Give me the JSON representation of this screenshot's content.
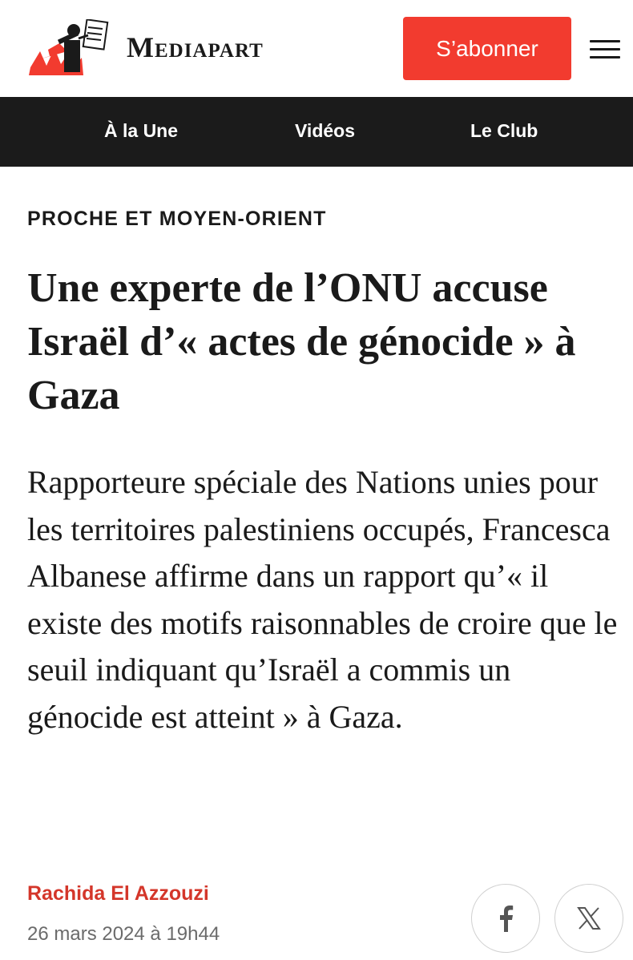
{
  "header": {
    "logo_text": "Mediapart",
    "subscribe_label": "S’abonner",
    "menu_icon": "hamburger-icon",
    "accent_color": "#f23b2f"
  },
  "nav": {
    "items": [
      {
        "label": "À la Une"
      },
      {
        "label": "Vidéos"
      },
      {
        "label": "Le Club"
      }
    ]
  },
  "article": {
    "category": "PROCHE ET MOYEN-ORIENT",
    "title": "Une experte de l’ONU accuse Israël d’« actes de génocide » à Gaza",
    "lead": "Rapporteure spéciale des Nations unies pour les territoires palestiniens occupés, Francesca Albanese affirme dans un rapport qu’« il existe des motifs raisonnables de croire que le seuil indiquant qu’Israël a commis un génocide est atteint » à Gaza.",
    "author": "Rachida El Azzouzi",
    "date": "26 mars 2024 à 19h44"
  },
  "share": {
    "facebook_icon": "facebook-icon",
    "x_icon": "x-icon"
  }
}
